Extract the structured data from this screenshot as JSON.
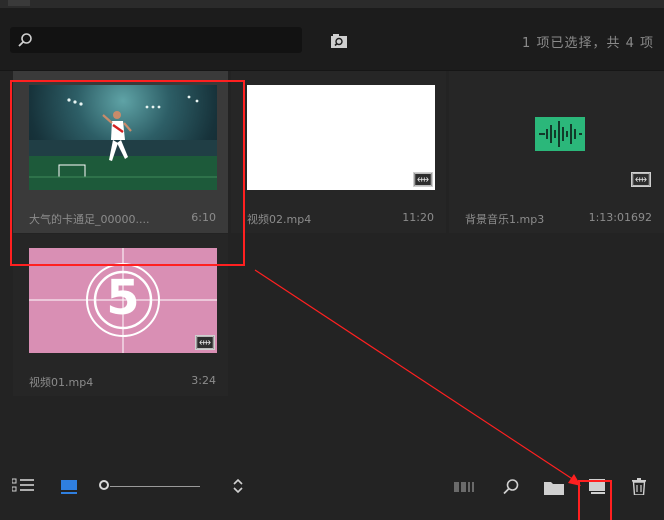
{
  "search": {
    "value": "",
    "placeholder": ""
  },
  "header": {
    "selection_status": "1 项已选择，共 4 项"
  },
  "items": [
    {
      "name": "大气的卡通足_00000....",
      "duration": "6:10",
      "type": "video",
      "selected": true
    },
    {
      "name": "视频02.mp4",
      "duration": "11:20",
      "type": "video",
      "selected": false
    },
    {
      "name": "背景音乐1.mp3",
      "duration": "1:13:01692",
      "type": "audio",
      "selected": false
    },
    {
      "name": "视频01.mp4",
      "duration": "3:24",
      "type": "video",
      "selected": false
    }
  ],
  "countdown": {
    "number": "5"
  },
  "colors": {
    "panel_bg": "#232323",
    "accent_blue": "#2f7fe0",
    "audio_green": "#2bb77a",
    "annotation_red": "#ff2020",
    "countdown_pink": "#d98fb4"
  },
  "icons": {
    "list_view": "list-icon",
    "thumb_view": "thumbnail-icon",
    "sort": "sort-updown-icon",
    "storyboard": "storyboard-icon",
    "search": "search-icon",
    "folder": "folder-icon",
    "new_item": "new-item-icon",
    "delete": "trash-icon"
  }
}
